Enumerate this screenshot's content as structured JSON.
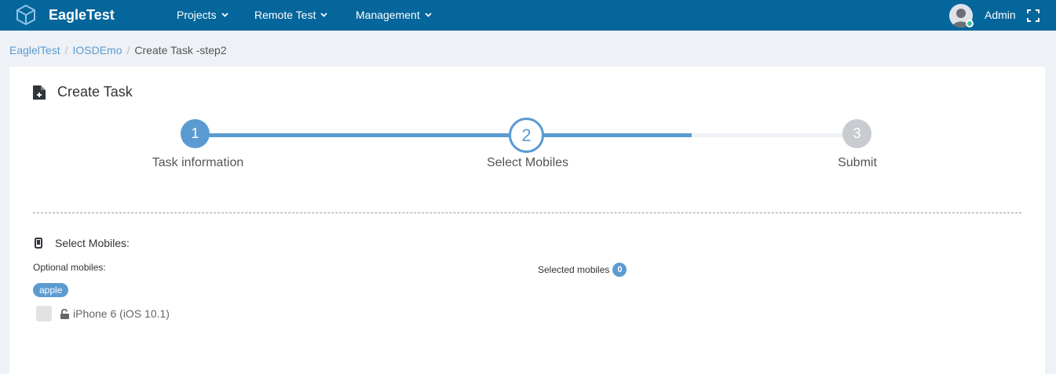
{
  "app": {
    "name": "EagleTest"
  },
  "nav": {
    "projects": "Projects",
    "remote_test": "Remote Test",
    "management": "Management"
  },
  "user": {
    "name": "Admin"
  },
  "breadcrumb": {
    "home": "EaglelTest",
    "project": "IOSDEmo",
    "current": "Create Task -step2"
  },
  "panel": {
    "title": "Create Task"
  },
  "wizard": {
    "steps": [
      {
        "number": "1",
        "label": "Task information"
      },
      {
        "number": "2",
        "label": "Select Mobiles"
      },
      {
        "number": "3",
        "label": "Submit"
      }
    ]
  },
  "mobiles": {
    "section_title": "Select Mobiles:",
    "optional_label": "Optional mobiles:",
    "selected_label": "Selected mobiles",
    "selected_count": "0",
    "group": "apple",
    "devices": [
      {
        "name": "iPhone 6 (iOS 10.1)"
      }
    ]
  },
  "colors": {
    "topbar": "#05669b",
    "accent": "#5b9bd1",
    "pending": "#c8ccd0"
  }
}
